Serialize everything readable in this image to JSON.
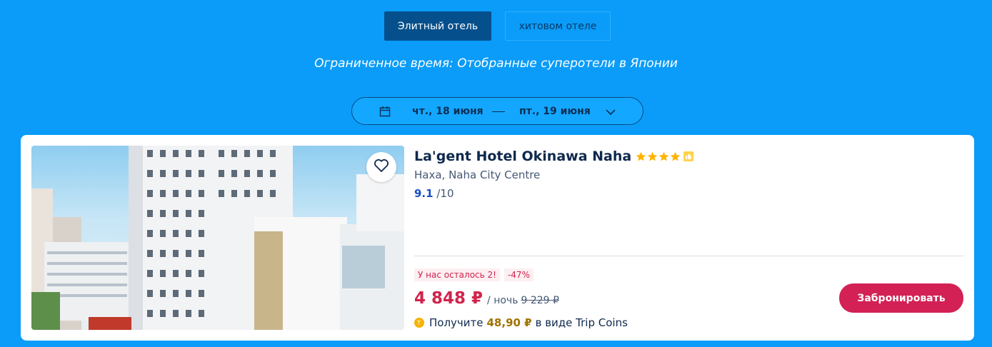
{
  "tabs": {
    "elite": "Элитный отель",
    "popular": "хитовом отеле"
  },
  "subtitle": "Ограниченное время: Отобранные суперотели в Японии",
  "dates": {
    "checkin": "чт., 18 июня",
    "checkout": "пт., 19 июня"
  },
  "hotel": {
    "name": "La'gent Hotel Okinawa Naha",
    "stars": 4,
    "location": "Наха, Naha City Centre",
    "rating_score": "9.1",
    "rating_max": "/10",
    "tags": {
      "rooms_left": "У нас осталось 2!",
      "discount": "-47%"
    },
    "price": "4 848 ₽",
    "per_night": "/ ночь",
    "old_price": "9 229 ₽",
    "coins_prefix": "Получите",
    "coins_amount": "48,90 ₽",
    "coins_suffix": "в виде Trip Coins",
    "book_label": "Забронировать"
  },
  "colors": {
    "background": "#0a9cf8",
    "active_tab": "#05508c",
    "price": "#d0244c",
    "book_button": "#d32155",
    "star": "#ffb400"
  },
  "icons": {
    "calendar": "calendar-icon",
    "chevron": "chevron-down-icon",
    "favorite": "heart-icon",
    "star": "star-icon",
    "coin": "coin-icon",
    "badge": "thumbs-up-icon"
  }
}
